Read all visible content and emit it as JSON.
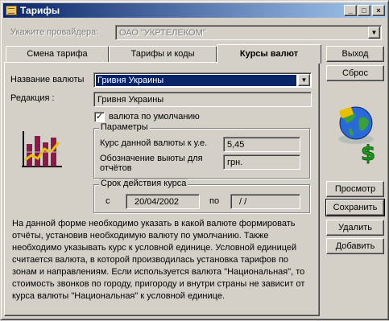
{
  "window": {
    "title": "Тарифы",
    "buttons": [
      "_",
      "□",
      "×"
    ]
  },
  "provider": {
    "label": "Укажите провайдера:",
    "value": "ОАО \"УКРТЕЛЕКОМ\""
  },
  "tabs": [
    {
      "label": "Смена тарифа",
      "active": false
    },
    {
      "label": "Тарифы и коды",
      "active": false
    },
    {
      "label": "Курсы валют",
      "active": true
    }
  ],
  "form": {
    "currency_name_label": "Название валюты",
    "currency_name_value": "Гривня Украины",
    "edition_label": "Редакция :",
    "edition_value": "Гривня Украины",
    "default_checkbox_label": "валюта по умолчанию",
    "default_checked": true,
    "params": {
      "title": "Параметры",
      "rate_label": "Курс данной валюты к у.е.",
      "rate_value": "5,45",
      "designation_label_line1": "Обозначение выюты для",
      "designation_label_line2": "отчётов",
      "designation_value": "грн."
    },
    "period": {
      "title": "Срок действия курса",
      "from_label": "с",
      "from_value": "20/04/2002",
      "to_label": "по",
      "to_value": " / /"
    },
    "info": "На данной форме необходимо указать в какой валюте формировать отчёты, установив необходимую валюту по умолчанию. Также необходимо указывать курс к условной единице. Условной единицей считается валюта, в которой производилась установка тарифов по зонам и направлениям. Если используется валюта \"Национальная\", то стоимость звонков по городу, пригороду и внутри страны не зависит от курса валюты \"Национальная\" к условной единице."
  },
  "buttons": {
    "exit": "Выход",
    "reset": "Сброс",
    "preview": "Просмотр",
    "save": "Сохранить",
    "delete": "Удалить",
    "add": "Добавить"
  },
  "icons": {
    "chart": "bar-chart-icon",
    "globe": "globe-money-icon"
  }
}
